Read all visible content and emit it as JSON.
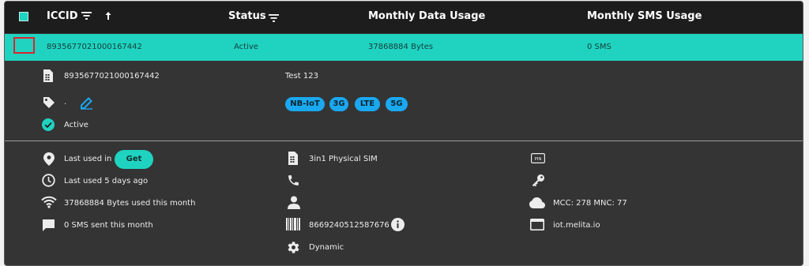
{
  "table": {
    "columns": [
      {
        "label": "ICCID"
      },
      {
        "label": "Status"
      },
      {
        "label": "Monthly Data Usage"
      },
      {
        "label": "Monthly SMS Usage"
      }
    ],
    "row": {
      "iccid": "8935677021000167442",
      "status": "Active",
      "data_usage": "37868884 Bytes",
      "sms_usage": "0 SMS"
    }
  },
  "detail": {
    "iccid": "8935677021000167442",
    "name": "Test 123",
    "tag_value": ".",
    "status": "Active",
    "networks": [
      "NB-IoT",
      "3G",
      "LTE",
      "5G"
    ],
    "last_used_in_label": "Last used in",
    "get_button": "Get",
    "last_used": "Last used 5 days ago",
    "data_month": "37868884 Bytes used this month",
    "sms_month": "0 SMS sent this month",
    "sim_type": "3in1 Physical SIM",
    "imei": "8669240512587676",
    "ip_type": "Dynamic",
    "pin_icon_text": "PIN",
    "mcc_mnc": "MCC: 278 MNC: 77",
    "apn": "iot.melita.io"
  },
  "colors": {
    "accent": "#1fd3c0",
    "chip": "#1aa8f0",
    "panel": "#343434",
    "header": "#1d1d1d",
    "highlight_border": "#d8262f"
  }
}
